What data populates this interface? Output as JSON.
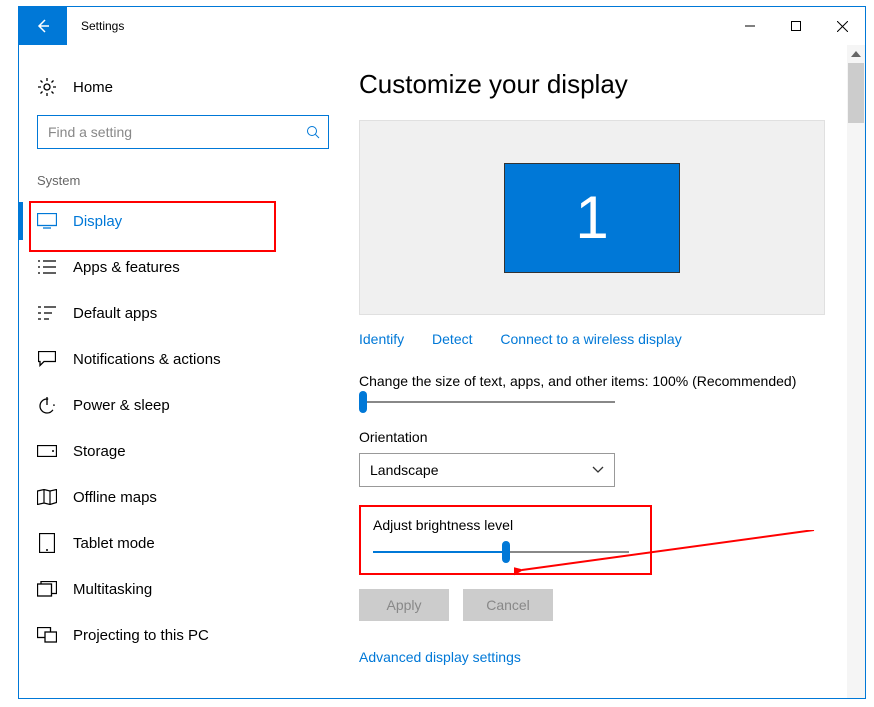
{
  "title": "Settings",
  "sidebar": {
    "home": "Home",
    "search_placeholder": "Find a setting",
    "section": "System",
    "items": [
      {
        "label": "Display",
        "active": true
      },
      {
        "label": "Apps & features"
      },
      {
        "label": "Default apps"
      },
      {
        "label": "Notifications & actions"
      },
      {
        "label": "Power & sleep"
      },
      {
        "label": "Storage"
      },
      {
        "label": "Offline maps"
      },
      {
        "label": "Tablet mode"
      },
      {
        "label": "Multitasking"
      },
      {
        "label": "Projecting to this PC"
      }
    ]
  },
  "main": {
    "heading": "Customize your display",
    "monitor_number": "1",
    "links": {
      "identify": "Identify",
      "detect": "Detect",
      "wireless": "Connect to a wireless display"
    },
    "scale_label": "Change the size of text, apps, and other items: 100% (Recommended)",
    "scale_value": 0,
    "orientation_label": "Orientation",
    "orientation_value": "Landscape",
    "brightness_label": "Adjust brightness level",
    "brightness_value": 52,
    "apply": "Apply",
    "cancel": "Cancel",
    "advanced": "Advanced display settings"
  }
}
